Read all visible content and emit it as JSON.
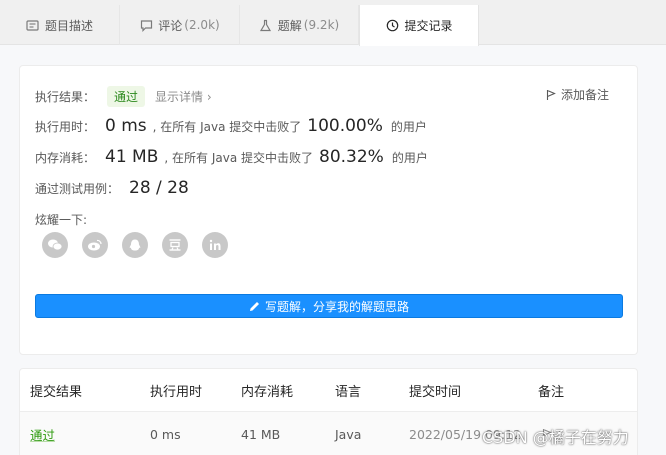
{
  "tabs": [
    {
      "label": "题目描述",
      "count": ""
    },
    {
      "label": "评论",
      "count": "(2.0k)"
    },
    {
      "label": "题解",
      "count": "(9.2k)"
    },
    {
      "label": "提交记录",
      "count": ""
    }
  ],
  "result": {
    "label": "执行结果：",
    "status": "通过",
    "details_link": "显示详情 ›",
    "add_note": "添加备注",
    "runtime_label": "执行用时：",
    "runtime_value": "0 ms",
    "runtime_text": ", 在所有 Java 提交中击败了",
    "runtime_pct": "100.00%",
    "runtime_suffix": "的用户",
    "memory_label": "内存消耗：",
    "memory_value": "41 MB",
    "memory_text": ", 在所有 Java 提交中击败了",
    "memory_pct": "80.32%",
    "memory_suffix": "的用户",
    "testcase_label": "通过测试用例：",
    "testcase_value": "28 / 28",
    "share_label": "炫耀一下:",
    "share_icons": [
      "wechat-icon",
      "weibo-icon",
      "qq-icon",
      "douban-icon",
      "linkedin-icon"
    ],
    "solution_button": "写题解，分享我的解题思路"
  },
  "table": {
    "headers": [
      "提交结果",
      "执行用时",
      "内存消耗",
      "语言",
      "提交时间",
      "备注"
    ],
    "rows": [
      {
        "result": "通过",
        "runtime": "0 ms",
        "memory": "41 MB",
        "language": "Java",
        "time": "2022/05/19 09:12"
      }
    ]
  },
  "watermark": "CSDN @橘子在努力",
  "colors": {
    "accent": "#1a90ff",
    "success": "#2d9a0d",
    "badge_bg": "#eef7e6"
  }
}
